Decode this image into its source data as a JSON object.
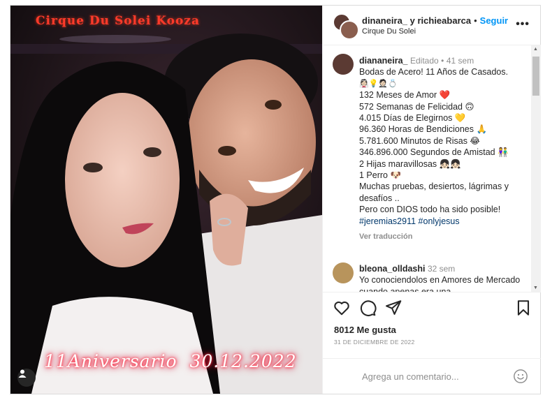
{
  "photo": {
    "title": "Cirque Du Solei Kooza",
    "caption": "11Aniversario  30.12.2022"
  },
  "header": {
    "users": "dinaneira_ y richieabarca",
    "separator": "•",
    "follow_label": "Seguir",
    "location": "Cirque Du Solei",
    "more_icon": "more-horizontal-icon"
  },
  "post": {
    "username": "diananeira_",
    "edited": "Editado",
    "separator": "•",
    "time": "41 sem",
    "lines": [
      "Bodas de Acero! 11 Años de Casados.",
      "👰🏻💡🤵🏻💍",
      "132 Meses de Amor ❤️",
      "572 Semanas de Felicidad 🙃",
      "4.015 Días de Elegirnos 💛",
      "96.360 Horas de Bendiciones 🙏",
      "5.781.600 Minutos de Risas 😂",
      "346.896.000 Segundos de Amistad 👫",
      "2 Hijas maravillosas 👧🏻👧🏻",
      "1 Perro 🐶",
      "Muchas pruebas, desiertos, lágrimas y desafíos ..",
      "Pero con DIOS todo ha sido posible!"
    ],
    "hashtags": "#jeremias2911 #onlyjesus",
    "translate_label": "Ver traducción"
  },
  "comment": {
    "username": "bleona_olldashi",
    "time": "32 sem",
    "text": "Yo conociendolos en Amores de Mercado cuando apenas era una"
  },
  "likes": "8012 Me gusta",
  "date": "31 DE DICIEMBRE DE 2022",
  "comment_input": {
    "placeholder": "Agrega un comentario..."
  }
}
